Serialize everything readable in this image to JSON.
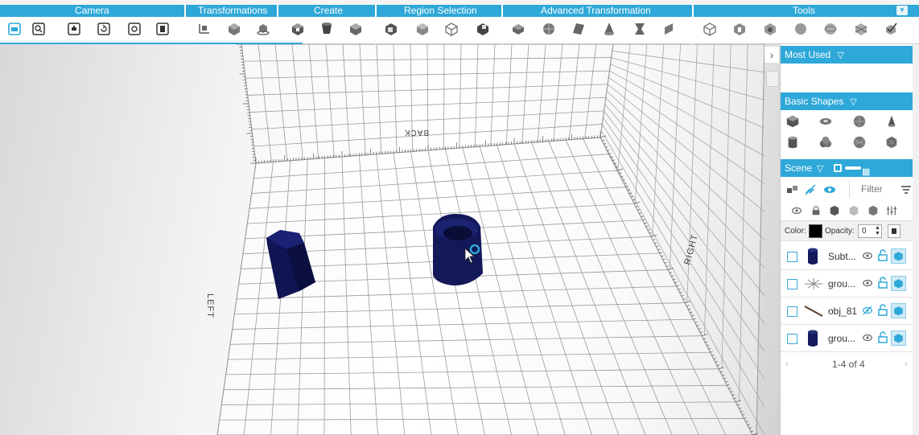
{
  "toolbar": {
    "groups": [
      "Camera",
      "Transformations",
      "Create",
      "Region Selection",
      "Advanced Transformation",
      "Tools"
    ],
    "collapse_icon": "chevron-down-icon",
    "accent": "#2ea8d8"
  },
  "viewport": {
    "labels": {
      "back": "BACK",
      "left": "LEFT",
      "right": "RIGHT"
    },
    "object_color": "#141a5c"
  },
  "panel": {
    "most_used": "Most Used",
    "basic_shapes": "Basic Shapes",
    "scene": "Scene",
    "filter_placeholder": "Filter",
    "color_label": "Color:",
    "opacity_label": "Opacity:",
    "opacity_value": "0",
    "rows": [
      {
        "name": "Subt..."
      },
      {
        "name": "grou..."
      },
      {
        "name": "obj_81"
      },
      {
        "name": "grou..."
      }
    ],
    "pager": "1-4 of 4"
  }
}
